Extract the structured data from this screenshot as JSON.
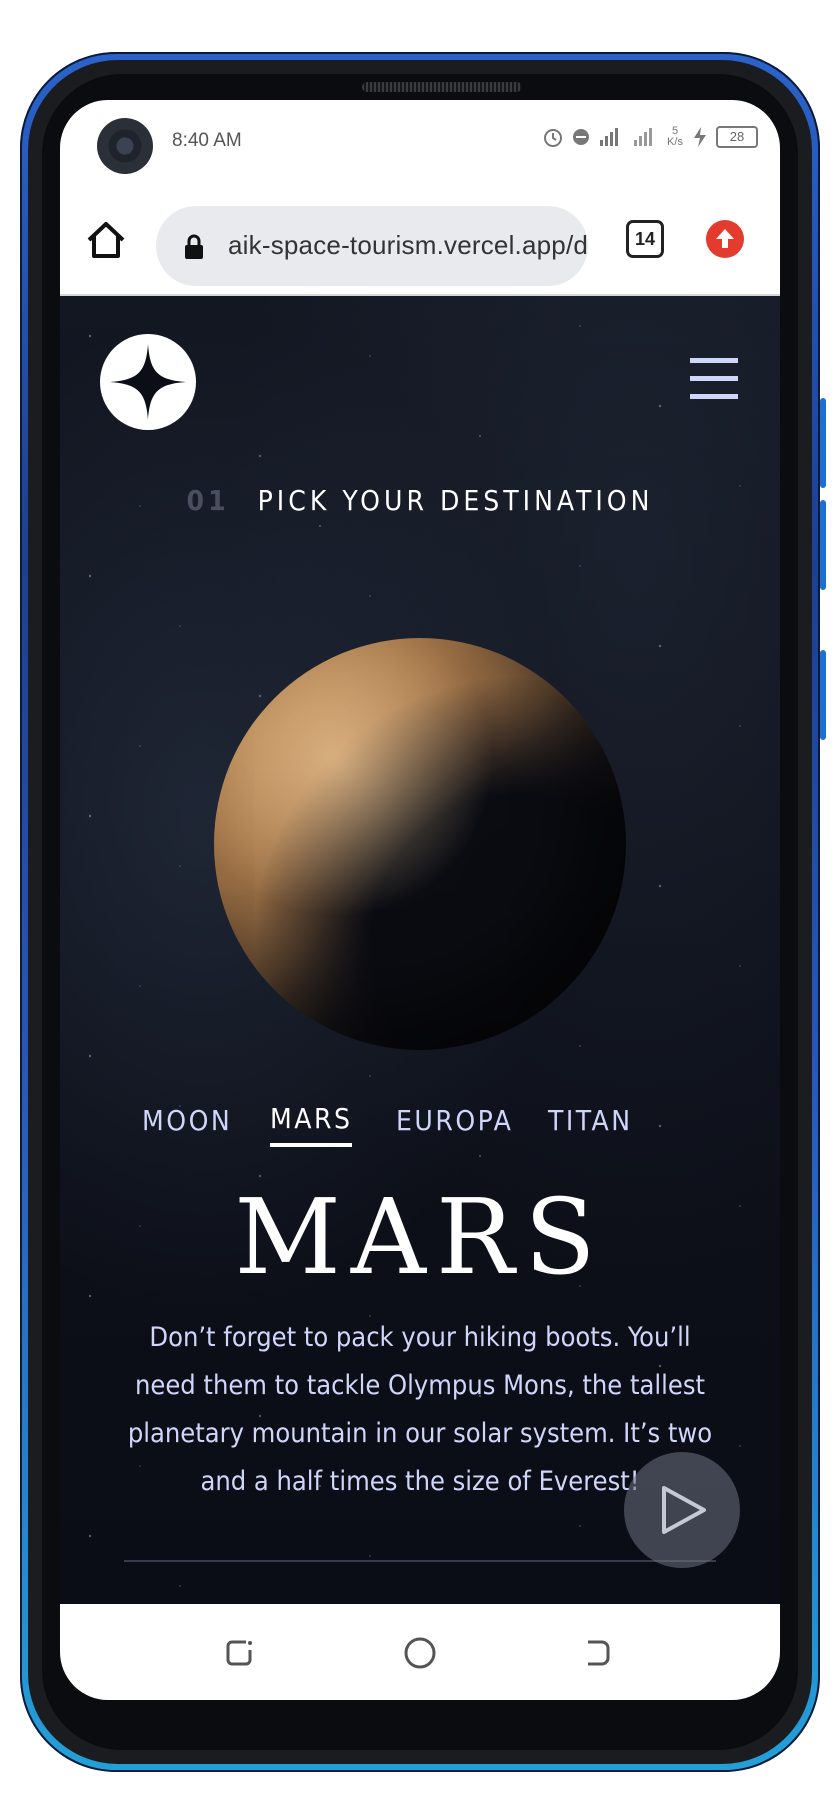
{
  "status_bar": {
    "time": "8:40 AM",
    "network_speed": "5\nK/s",
    "battery_level": "28"
  },
  "browser": {
    "url": "aik-space-tourism.vercel.app/destination",
    "tab_count": "14"
  },
  "page": {
    "section_number": "01",
    "section_title": "PICK YOUR DESTINATION",
    "tabs": [
      {
        "label": "MOON",
        "active": false
      },
      {
        "label": "MARS",
        "active": true
      },
      {
        "label": "EUROPA",
        "active": false
      },
      {
        "label": "TITAN",
        "active": false
      }
    ],
    "planet_name": "MARS",
    "description": "Don’t forget to pack your hiking boots. You’ll need them to tackle Olympus Mons, the tallest planetary mountain in our solar system. It’s two and a half times the size of Everest!"
  },
  "colors": {
    "accent_light": "#d0d6f9",
    "background_dark": "#0b0d17",
    "extension_red": "#e33b2e"
  },
  "icons": [
    "home-icon",
    "lock-icon",
    "tabs-counter-icon",
    "extension-icon",
    "logo-star-icon",
    "hamburger-icon",
    "play-icon",
    "recents-icon",
    "home-circle-icon",
    "back-icon",
    "alarm-icon",
    "dnd-icon",
    "signal-icon",
    "charging-icon",
    "battery-icon"
  ]
}
